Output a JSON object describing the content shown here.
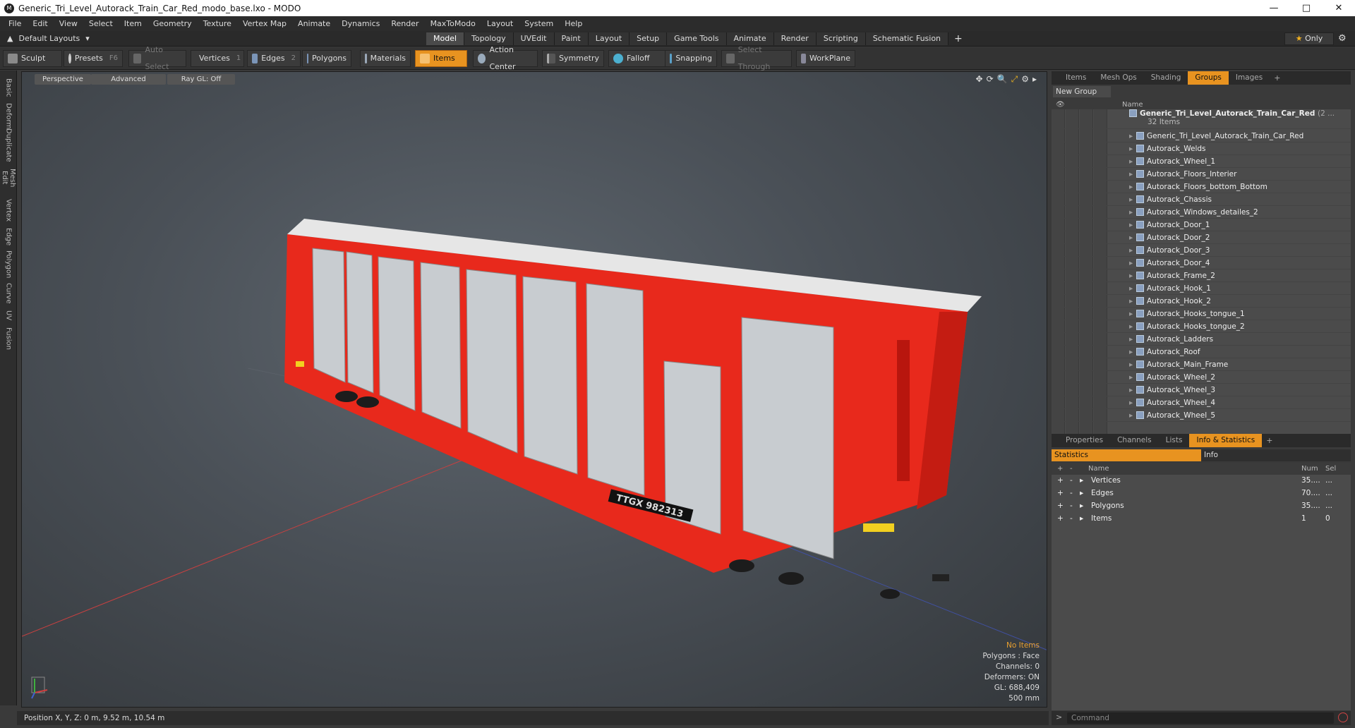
{
  "window": {
    "title": "Generic_Tri_Level_Autorack_Train_Car_Red_modo_base.lxo - MODO",
    "app_icon": "modo-logo-icon",
    "controls": [
      "minimize",
      "maximize",
      "close"
    ]
  },
  "menu": [
    "File",
    "Edit",
    "View",
    "Select",
    "Item",
    "Geometry",
    "Texture",
    "Vertex Map",
    "Animate",
    "Dynamics",
    "Render",
    "MaxToModo",
    "Layout",
    "System",
    "Help"
  ],
  "layout": {
    "selector": "Default Layouts",
    "tabs": [
      "Model",
      "Topology",
      "UVEdit",
      "Paint",
      "Layout",
      "Setup",
      "Game Tools",
      "Animate",
      "Render",
      "Scripting",
      "Schematic Fusion"
    ],
    "active_tab": "Model",
    "only_label": "Only"
  },
  "toolbar": {
    "sculpt": "Sculpt",
    "presets": "Presets",
    "presets_key": "F6",
    "auto_select": "Auto Select",
    "vertices": "Vertices",
    "vertices_key": "1",
    "edges": "Edges",
    "edges_key": "2",
    "polygons": "Polygons",
    "materials": "Materials",
    "items": "Items",
    "action_center": "Action Center",
    "symmetry": "Symmetry",
    "falloff": "Falloff",
    "snapping": "Snapping",
    "select_through": "Select Through",
    "workplane": "WorkPlane"
  },
  "left_tabs": [
    "Basic",
    "Deform",
    "Duplicate",
    "Mesh Edit",
    "Vertex",
    "Edge",
    "Polygon",
    "Curve",
    "UV",
    "Fusion"
  ],
  "viewport": {
    "view_mode": "Perspective",
    "shading": "Advanced",
    "raygl": "Ray GL: Off",
    "car_marking": "TTGX 982313",
    "info": {
      "selection": "No Items",
      "polygons": "Polygons : Face",
      "channels": "Channels: 0",
      "deformers": "Deformers: ON",
      "gl": "GL: 688,409",
      "scale": "500 mm"
    }
  },
  "status": {
    "position": "Position X, Y, Z:  0 m, 9.52 m, 10.54 m"
  },
  "outliner": {
    "tabs": [
      "Items",
      "Mesh Ops",
      "Shading",
      "Groups",
      "Images"
    ],
    "active_tab": "Groups",
    "new_group": "New Group",
    "column_name": "Name",
    "group": {
      "name": "Generic_Tri_Level_Autorack_Train_Car_Red",
      "suffix": "(2 ...",
      "count": "32 Items"
    },
    "items": [
      "Generic_Tri_Level_Autorack_Train_Car_Red",
      "Autorack_Welds",
      "Autorack_Wheel_1",
      "Autorack_Floors_Interier",
      "Autorack_Floors_bottom_Bottom",
      "Autorack_Chassis",
      "Autorack_Windows_detailes_2",
      "Autorack_Door_1",
      "Autorack_Door_2",
      "Autorack_Door_3",
      "Autorack_Door_4",
      "Autorack_Frame_2",
      "Autorack_Hook_1",
      "Autorack_Hook_2",
      "Autorack_Hooks_tongue_1",
      "Autorack_Hooks_tongue_2",
      "Autorack_Ladders",
      "Autorack_Roof",
      "Autorack_Main_Frame",
      "Autorack_Wheel_2",
      "Autorack_Wheel_3",
      "Autorack_Wheel_4",
      "Autorack_Wheel_5"
    ]
  },
  "properties": {
    "tabs": [
      "Properties",
      "Channels",
      "Lists",
      "Info & Statistics"
    ],
    "active_tab": "Info & Statistics",
    "sub_tabs": [
      "Statistics",
      "Info"
    ],
    "columns": [
      "Name",
      "Num",
      "Sel"
    ],
    "rows": [
      {
        "name": "Vertices",
        "num": "35....",
        "sel": "..."
      },
      {
        "name": "Edges",
        "num": "70....",
        "sel": "..."
      },
      {
        "name": "Polygons",
        "num": "35....",
        "sel": "..."
      },
      {
        "name": "Items",
        "num": "1",
        "sel": "0"
      }
    ]
  },
  "command": {
    "placeholder": "Command"
  },
  "colors": {
    "accent": "#e89320",
    "car_red": "#e8291c",
    "roof": "#e6e6e6"
  }
}
